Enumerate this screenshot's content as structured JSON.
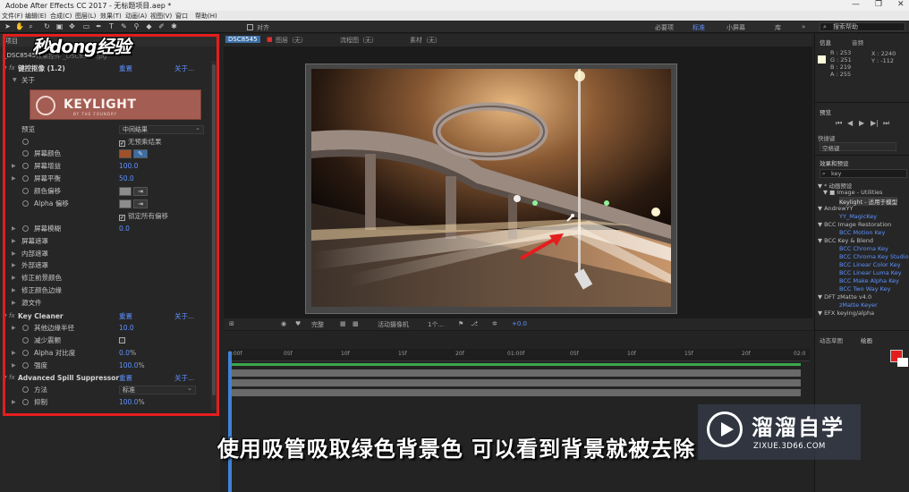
{
  "window": {
    "title": "Adobe After Effects CC 2017 - 无标题项目.aep *",
    "controls": [
      "—",
      "❐",
      "✕"
    ]
  },
  "menu": [
    "文件(F)",
    "编辑(E)",
    "合成(C)",
    "图层(L)",
    "效果(T)",
    "动画(A)",
    "视图(V)",
    "窗口",
    "帮助(H)"
  ],
  "toolbar": {
    "snap_label": "对齐",
    "workspaces": [
      {
        "label": "必要项",
        "active": false
      },
      {
        "label": "标准",
        "active": true
      },
      {
        "label": "小屏幕",
        "active": false
      },
      {
        "label": "库",
        "active": false
      }
    ],
    "search_placeholder": "搜索帮助"
  },
  "watermark_logo": "秒dong经验",
  "project_panel": {
    "tab_label": "项目",
    "layer_label": "_DSC8545",
    "effect_controls_label": "效果控件 _DSC8545.jpg"
  },
  "effects": {
    "keying_header": "键控抠像 (1.2)",
    "reset": "重置",
    "about": "关于...",
    "about_row": "关于",
    "keylight_logo": "KEYLIGHT",
    "keylight_sub": "BY THE FOUNDRY",
    "rows": [
      {
        "label": "预览",
        "value": "中间结果",
        "kind": "select"
      },
      {
        "label": "",
        "value": "无预乘结果",
        "kind": "checkbox",
        "checked": true
      },
      {
        "label": "屏幕颜色",
        "kind": "color",
        "color": "#a0512a"
      },
      {
        "label": "屏幕增益",
        "value": "100.0",
        "kind": "value"
      },
      {
        "label": "屏幕平衡",
        "value": "50.0",
        "kind": "value"
      },
      {
        "label": "颜色偏移",
        "kind": "color",
        "color": "#8c8c8c"
      },
      {
        "label": "Alpha 偏移",
        "kind": "color",
        "color": "#8c8c8c"
      },
      {
        "label": "",
        "value": "锁定所有偏移",
        "kind": "checkbox",
        "checked": true
      },
      {
        "label": "屏幕模糊",
        "value": "0.0",
        "kind": "value"
      },
      {
        "label": "屏幕遮罩",
        "kind": "group"
      },
      {
        "label": "内部遮罩",
        "kind": "group"
      },
      {
        "label": "外部遮罩",
        "kind": "group"
      },
      {
        "label": "修正前景颜色",
        "kind": "group"
      },
      {
        "label": "修正颜色边缘",
        "kind": "group"
      },
      {
        "label": "源文件",
        "kind": "group"
      }
    ],
    "key_cleaner": {
      "title": "Key Cleaner",
      "rows": [
        {
          "label": "其他边缘半径",
          "value": "10.0"
        },
        {
          "label": "减少震颤",
          "value": ""
        },
        {
          "label": "Alpha 对比度",
          "value": "0.0",
          "unit": "%"
        },
        {
          "label": "强度",
          "value": "100.0",
          "unit": "%"
        }
      ]
    },
    "spill": {
      "title": "Advanced Spill Suppressor",
      "rows": [
        {
          "label": "方法",
          "value": "标准"
        },
        {
          "label": "抑制",
          "value": "100.0",
          "unit": "%"
        }
      ]
    }
  },
  "viewer": {
    "tabs": [
      "DSC8545",
      "图层（无）",
      "流程图（无）",
      "素材（无）"
    ],
    "controls": [
      "完整",
      "活动摄像机",
      "1个...",
      "+0.0"
    ]
  },
  "timeline": {
    "ticks": [
      "0:00f",
      "05f",
      "10f",
      "15f",
      "20f",
      "01:00f",
      "05f",
      "10f",
      "15f",
      "20f",
      "02:0"
    ]
  },
  "right": {
    "info_tab": "信息",
    "audio_tab": "音频",
    "info": [
      "R : 253",
      "G : 251",
      "B : 219",
      "A : 255"
    ],
    "xy": [
      "X : 2240",
      "Y : -112"
    ],
    "preview_tab": "预览",
    "shortcut_label": "快捷键",
    "shortcut_value": "空格键",
    "effects_tab": "效果和预设",
    "search_value": "key",
    "tree": [
      {
        "t": "▼ * 动画预设",
        "kind": "grp",
        "x": 4
      },
      {
        "t": "▼ ■ Image - Utilities",
        "kind": "grp",
        "x": 10
      },
      {
        "t": "Keylight - 适用于模型",
        "kind": "item",
        "x": 28
      },
      {
        "t": "▼ AndrewYY",
        "kind": "grp",
        "x": 4
      },
      {
        "t": "YY_MagicKey",
        "kind": "item",
        "x": 28
      },
      {
        "t": "▼ BCC Image Restoration",
        "kind": "grp",
        "x": 4
      },
      {
        "t": "BCC Motion Key",
        "kind": "item",
        "x": 28
      },
      {
        "t": "▼ BCC Key & Blend",
        "kind": "grp",
        "x": 4
      },
      {
        "t": "BCC Chroma Key",
        "kind": "item",
        "x": 28
      },
      {
        "t": "BCC Chroma Key Studio",
        "kind": "item",
        "x": 28
      },
      {
        "t": "BCC Linear Color Key",
        "kind": "item",
        "x": 28
      },
      {
        "t": "BCC Linear Luma Key",
        "kind": "item",
        "x": 28
      },
      {
        "t": "BCC Make Alpha Key",
        "kind": "item",
        "x": 28
      },
      {
        "t": "BCC Two Way Key",
        "kind": "item",
        "x": 28
      },
      {
        "t": "▼ DFT zMatte v4.0",
        "kind": "grp",
        "x": 4
      },
      {
        "t": "zMatte Keyer",
        "kind": "item",
        "x": 28
      },
      {
        "t": "▼ EFX keying/alpha",
        "kind": "grp",
        "x": 4
      }
    ],
    "motion_tab": "动态草图",
    "paint_tab": "绘画"
  },
  "subtitle": "使用吸管吸取绿色背景色  可以看到背景就被去除",
  "brand": {
    "name": "溜溜自学",
    "url": "ZIXUE.3D66.COM"
  },
  "colors": {
    "accent_blue": "#5e92ff",
    "highlight_red": "#e31e1e",
    "keylight_bg": "#a35d53",
    "info_swatch": "#fdfbdb"
  }
}
